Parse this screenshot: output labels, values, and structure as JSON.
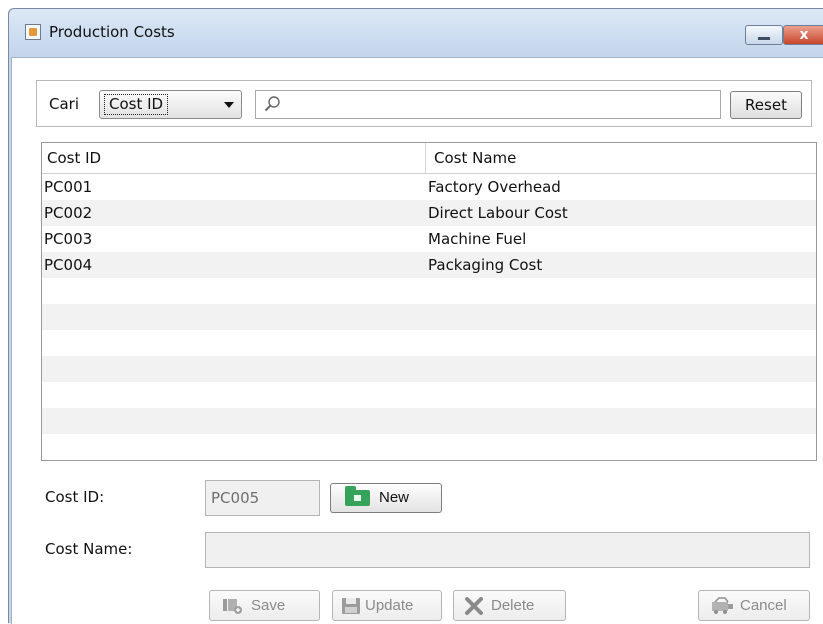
{
  "window": {
    "title": "Production Costs",
    "close_glyph": "x"
  },
  "search": {
    "label": "Cari",
    "field_selected": "Cost ID",
    "query": "",
    "reset_label": "Reset"
  },
  "table": {
    "columns": [
      "Cost ID",
      "Cost Name"
    ],
    "rows": [
      {
        "id": "PC001",
        "name": "Factory Overhead"
      },
      {
        "id": "PC002",
        "name": "Direct Labour Cost"
      },
      {
        "id": "PC003",
        "name": "Machine Fuel"
      },
      {
        "id": "PC004",
        "name": "Packaging Cost"
      }
    ]
  },
  "form": {
    "cost_id_label": "Cost ID:",
    "cost_id_value": "PC005",
    "new_label": "New",
    "cost_name_label": "Cost Name:",
    "cost_name_value": ""
  },
  "actions": {
    "save_label": "Save",
    "update_label": "Update",
    "delete_label": "Delete",
    "cancel_label": "Cancel"
  },
  "colors": {
    "title_bar": "#c5d6ea",
    "close_button": "#c7452a",
    "new_icon": "#35a35a",
    "row_alt": "#f2f2f2",
    "disabled_text": "#8a8a8a"
  },
  "icons": {
    "app": "java-app-icon",
    "search": "magnifier-icon",
    "new": "folder-add-icon",
    "save": "save-icon",
    "update": "update-icon",
    "delete": "delete-x-icon",
    "cancel": "cancel-icon"
  }
}
